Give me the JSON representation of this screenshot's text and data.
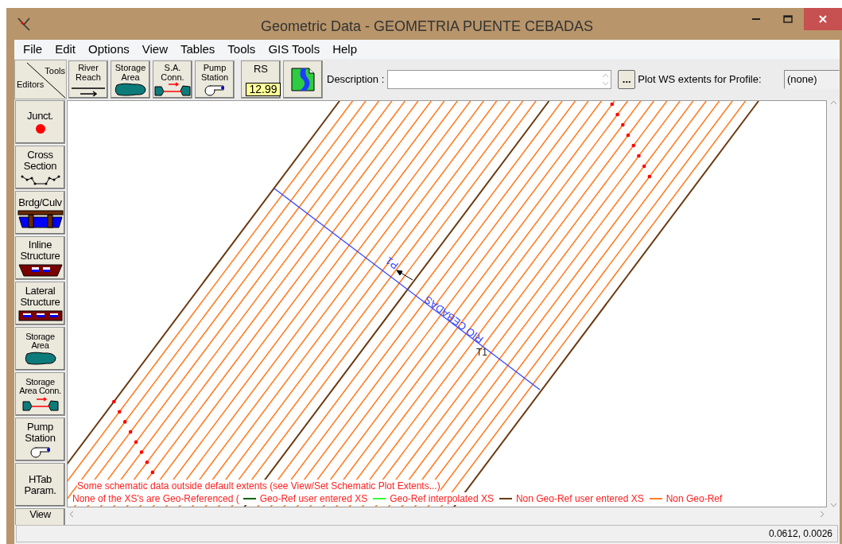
{
  "window": {
    "title": "Geometric Data - GEOMETRIA PUENTE CEBADAS"
  },
  "menu": [
    "File",
    "Edit",
    "Options",
    "View",
    "Tables",
    "Tools",
    "GIS Tools",
    "Help"
  ],
  "toolbar": {
    "corner": {
      "top": "Tools",
      "bottom": "Editors"
    },
    "tools": [
      {
        "kind": "reach",
        "label": "River Reach"
      },
      {
        "kind": "storage",
        "label": "Storage Area"
      },
      {
        "kind": "saconn",
        "label": "S.A. Conn."
      },
      {
        "kind": "pump",
        "label": "Pump Station"
      },
      {
        "kind": "rs",
        "label": "RS",
        "value": "12.99"
      },
      {
        "kind": "map"
      }
    ],
    "description": {
      "label": "Description :"
    },
    "ellipsis": "...",
    "profile": {
      "label": "Plot WS extents for Profile:",
      "value": "(none)"
    }
  },
  "editors": [
    {
      "kind": "junction",
      "label": "Junct."
    },
    {
      "kind": "xs",
      "label": "Cross Section"
    },
    {
      "kind": "bridge",
      "label": "Brdg/Culv"
    },
    {
      "kind": "inline",
      "label": "Inline Structure"
    },
    {
      "kind": "lateral",
      "label": "Lateral Structure"
    },
    {
      "kind": "storage",
      "label": "Storage Area"
    },
    {
      "kind": "saconn",
      "label": "Storage Area Conn."
    },
    {
      "kind": "pump",
      "label": "Pump Station"
    },
    {
      "kind": "text",
      "label": "HTab Param."
    },
    {
      "kind": "text",
      "label": "View"
    }
  ],
  "schematic": {
    "river": "RIO CEBADAS",
    "reach": "P1",
    "node": "T1",
    "notice": "Some schematic data outside default extents (see View/Set Schematic Plot Extents...)",
    "legend_intro": "None of the XS's are Geo-Referenced (",
    "legend": [
      {
        "label": "Geo-Ref user entered XS",
        "color": "#006400"
      },
      {
        "label": "Geo-Ref interpolated XS",
        "color": "#33ff33"
      },
      {
        "label": "Non Geo-Ref user entered XS",
        "color": "#6b3a10"
      },
      {
        "label": "Non Geo-Ref",
        "color": "#ff7f27"
      }
    ]
  },
  "status_bar": {
    "coordinates": "0.0612, 0.0026"
  }
}
